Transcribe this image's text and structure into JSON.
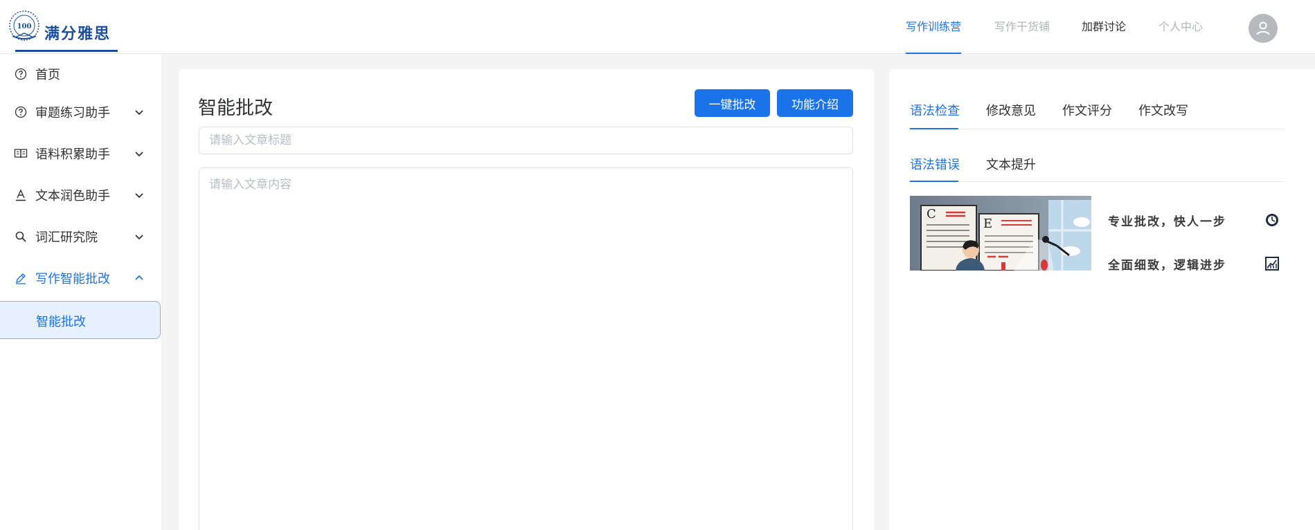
{
  "logo": {
    "badge": "100",
    "text": "满分雅思"
  },
  "header": {
    "nav": [
      {
        "label": "写作训练营",
        "state": "active"
      },
      {
        "label": "写作干货铺",
        "state": "muted"
      },
      {
        "label": "加群讨论",
        "state": "dark"
      },
      {
        "label": "个人中心",
        "state": "muted"
      }
    ],
    "avatar_icon": "user-icon"
  },
  "sidebar": {
    "items": [
      {
        "label": "首页",
        "icon": "question-circle-icon"
      },
      {
        "label": "审题练习助手",
        "icon": "question-circle-icon"
      },
      {
        "label": "语料积累助手",
        "icon": "book-icon"
      },
      {
        "label": "文本润色助手",
        "icon": "text-underline-icon"
      },
      {
        "label": "词汇研究院",
        "icon": "search-icon"
      },
      {
        "label": "写作智能批改",
        "icon": "pen-icon"
      }
    ],
    "sub_item": {
      "label": "智能批改"
    }
  },
  "main": {
    "title": "智能批改",
    "buttons": {
      "correct": "一键批改",
      "intro": "功能介绍"
    },
    "title_input": {
      "value": "",
      "placeholder": "请输入文章标题"
    },
    "content_input": {
      "value": "",
      "placeholder": "请输入文章内容"
    }
  },
  "right": {
    "tabs": [
      "语法检查",
      "修改意见",
      "作文评分",
      "作文改写"
    ],
    "subtabs": [
      "语法错误",
      "文本提升"
    ],
    "banner": {
      "line1": "专业批改，快人一步",
      "line2": "全面细致，逻辑进步",
      "illus_letters": [
        "C",
        "E"
      ]
    }
  },
  "colors": {
    "accent": "#1a73e8",
    "muted": "#b0b3b8",
    "brand": "#1b4f9c"
  }
}
